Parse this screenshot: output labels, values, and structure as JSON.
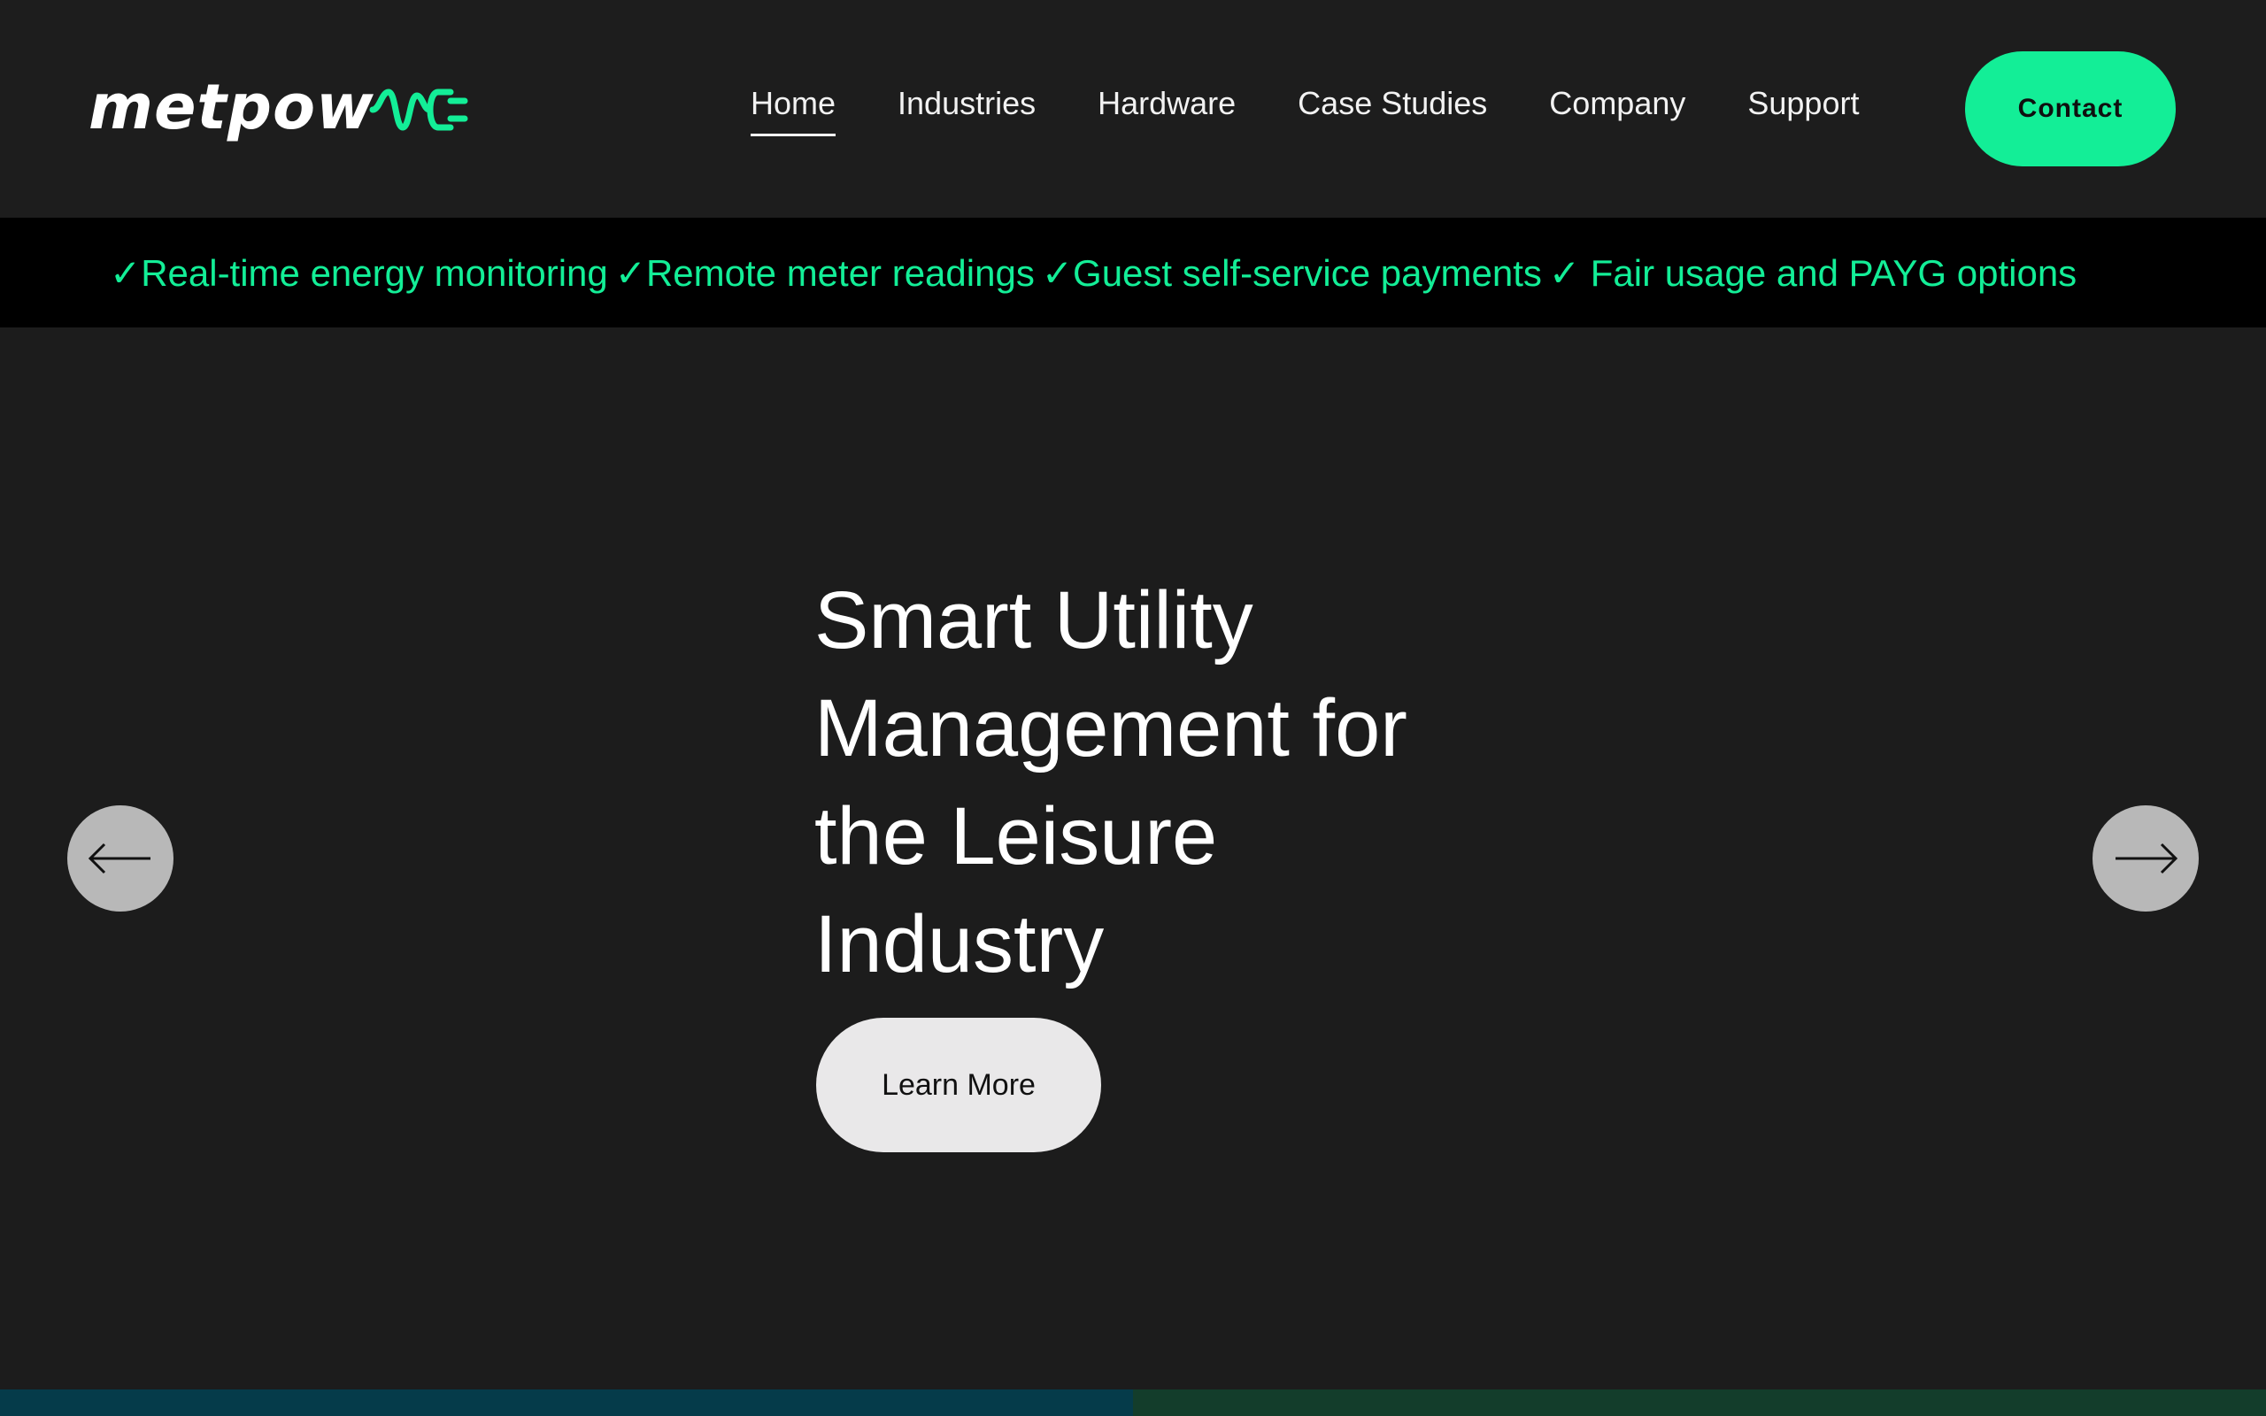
{
  "brand": {
    "name": "metpow",
    "accent_color": "#13ee97",
    "logo_icon": "plug-icon"
  },
  "nav": {
    "items": [
      {
        "label": "Home",
        "active": true
      },
      {
        "label": "Industries",
        "active": false
      },
      {
        "label": "Hardware",
        "active": false
      },
      {
        "label": "Case Studies",
        "active": false
      },
      {
        "label": "Company",
        "active": false
      },
      {
        "label": "Support",
        "active": false
      }
    ],
    "contact_label": "Contact"
  },
  "features": [
    "✓Real-time energy monitoring",
    "✓Remote meter readings",
    "✓Guest self-service payments",
    "✓ Fair usage and PAYG options"
  ],
  "hero": {
    "title_lines": [
      "Smart Utility",
      "Management for",
      "the Leisure",
      "Industry"
    ],
    "cta_label": "Learn More",
    "prev_icon": "arrow-left-icon",
    "next_icon": "arrow-right-icon"
  },
  "colors": {
    "background": "#1c1c1c",
    "strip_background": "#000000",
    "contact_button": "#13ee97",
    "cta_button": "#e9e8e9",
    "arrow_button": "#b8b8b8",
    "bottom_left": "#053b4a",
    "bottom_right": "#133d2b"
  }
}
